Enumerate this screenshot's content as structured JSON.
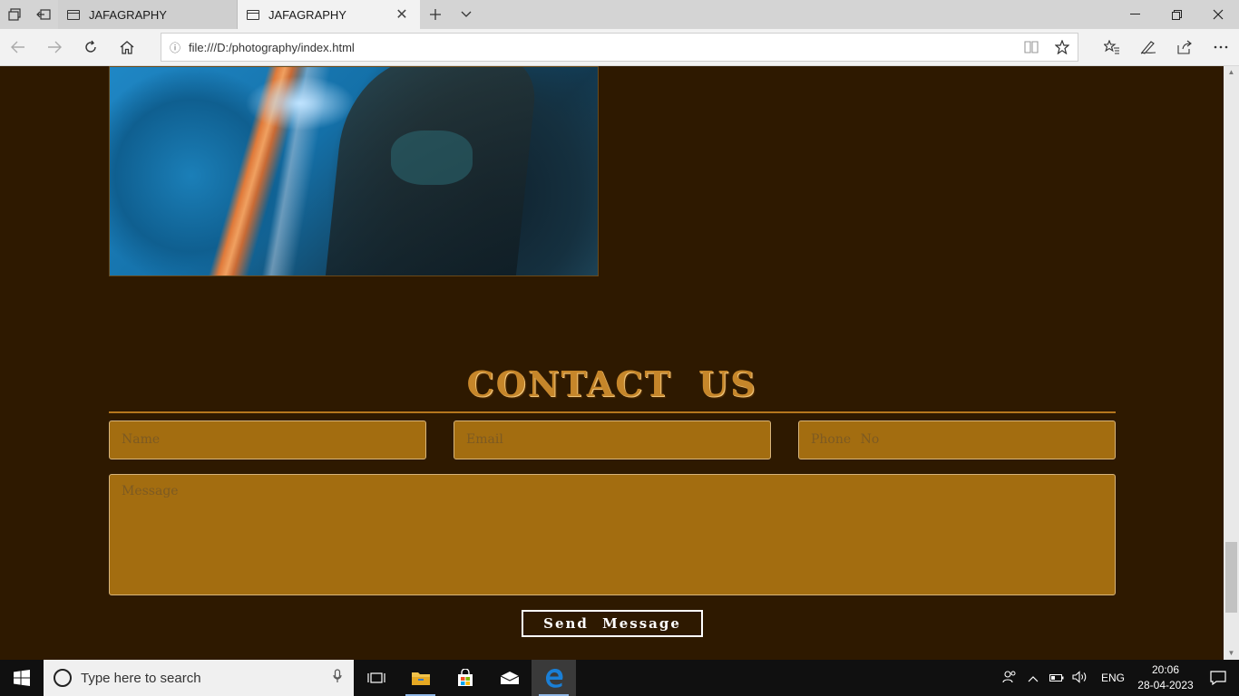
{
  "browser": {
    "tabs": [
      {
        "title": "JAFAGRAPHY",
        "active": false
      },
      {
        "title": "JAFAGRAPHY",
        "active": true
      }
    ],
    "url": "file:///D:/photography/index.html"
  },
  "page": {
    "contact_title": "CONTACT  US",
    "form": {
      "name_placeholder": "Name",
      "email_placeholder": "Email",
      "phone_placeholder": "Phone  No",
      "message_placeholder": "Message",
      "submit_label": "Send  Message"
    },
    "colors": {
      "background": "#2e1900",
      "field_fill": "#a36d10",
      "title": "#c6862a"
    }
  },
  "taskbar": {
    "search_placeholder": "Type here to search",
    "language": "ENG",
    "time": "20:06",
    "date": "28-04-2023"
  }
}
